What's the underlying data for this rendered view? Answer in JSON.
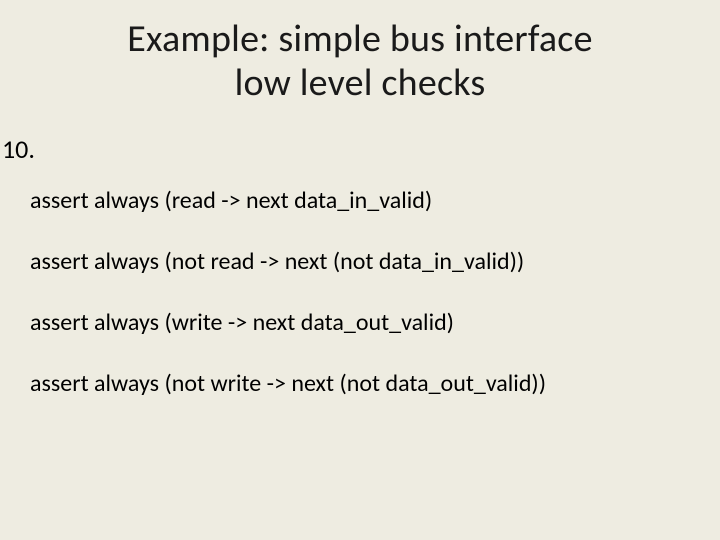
{
  "title_line1": "Example: simple bus interface",
  "title_line2": "low level checks",
  "list_number": "10.",
  "assertions": {
    "a0": "assert always (read -> next  data_in_valid)",
    "a1": "assert always (not read -> next (not data_in_valid))",
    "a2": "assert always (write -> next data_out_valid)",
    "a3": "assert always (not write -> next (not data_out_valid))"
  }
}
